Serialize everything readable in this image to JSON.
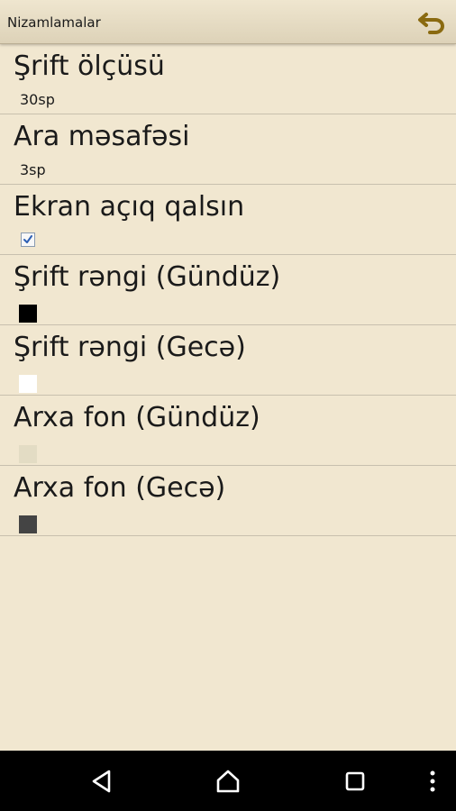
{
  "titlebar": {
    "title": "Nizamlamalar",
    "back_icon": "undo-arrow-icon",
    "accent_color": "#8a6a10"
  },
  "settings": [
    {
      "label": "Şrift ölçüsü",
      "value": "30sp"
    },
    {
      "label": "Ara məsafəsi",
      "value": "3sp"
    },
    {
      "label": "Ekran açıq qalsın",
      "checked": true
    },
    {
      "label": "Şrift rəngi (Gündüz)",
      "color": "#000000"
    },
    {
      "label": "Şrift rəngi (Gecə)",
      "color": "#ffffff"
    },
    {
      "label": "Arxa fon (Gündüz)",
      "color": "#e3dcc4"
    },
    {
      "label": "Arxa fon (Gecə)",
      "color": "#444444"
    }
  ],
  "navbar": {
    "back_icon": "triangle-back-icon",
    "home_icon": "home-icon",
    "recents_icon": "square-recents-icon",
    "menu_icon": "vertical-dots-menu-icon"
  }
}
